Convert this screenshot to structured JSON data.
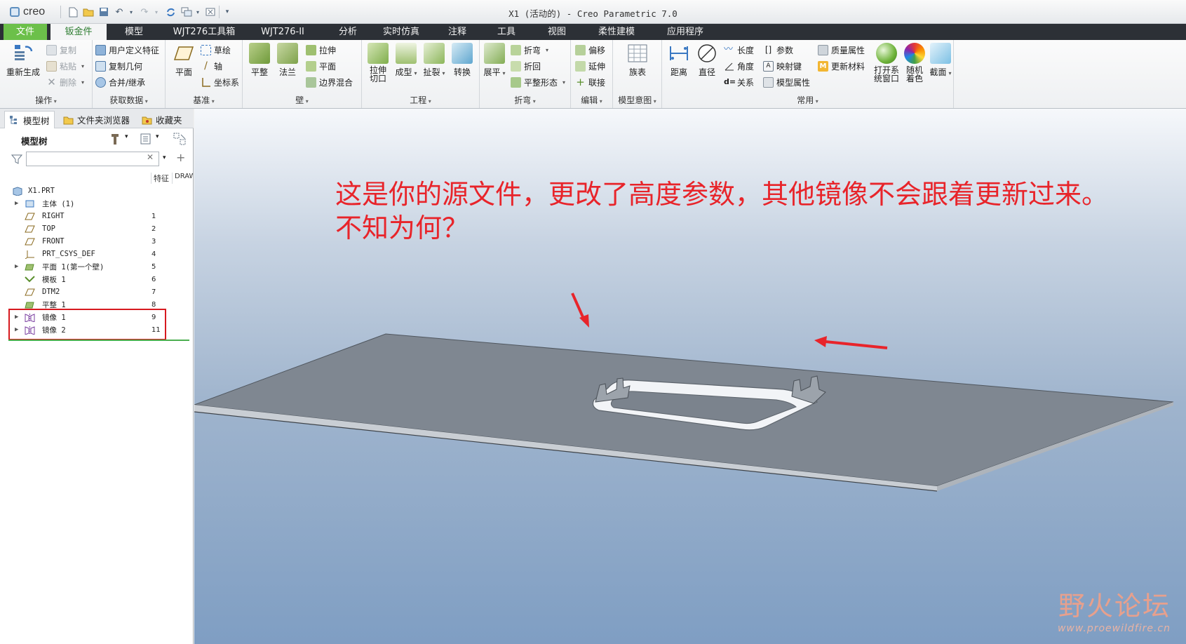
{
  "app": {
    "logo_text": "creo",
    "window_title": "X1 (活动的) - Creo Parametric 7.0"
  },
  "tabs": [
    {
      "label": "文件"
    },
    {
      "label": "钣金件"
    },
    {
      "label": "模型"
    },
    {
      "label": "WJT276工具箱"
    },
    {
      "label": "WJT276-II"
    },
    {
      "label": "分析"
    },
    {
      "label": "实时仿真"
    },
    {
      "label": "注释"
    },
    {
      "label": "工具"
    },
    {
      "label": "视图"
    },
    {
      "label": "柔性建模"
    },
    {
      "label": "应用程序"
    }
  ],
  "ribbon": {
    "operations": {
      "label": "操作",
      "regenerate": "重新生成",
      "copy": "复制",
      "paste": "粘贴",
      "delete": "删除"
    },
    "get_data": {
      "label": "获取数据",
      "udf": "用户定义特征",
      "copy_geom": "复制几何",
      "merge": "合并/继承"
    },
    "datum": {
      "label": "基准",
      "plane": "平面",
      "sketch": "草绘",
      "axis": "轴",
      "csys": "坐标系"
    },
    "wall": {
      "label": "壁",
      "flat": "平整",
      "flange": "法兰",
      "extrude": "拉伸",
      "planar": "平面",
      "blend": "边界混合"
    },
    "engineering": {
      "label": "工程",
      "extrude_cut": "拉伸切口",
      "form": "成型",
      "rip": "扯裂",
      "convert": "转换"
    },
    "bend": {
      "label": "折弯",
      "unbend": "展平",
      "bend": "折弯",
      "bend_back": "折回",
      "flat_pattern": "平整形态"
    },
    "edit": {
      "label": "编辑",
      "offset": "偏移",
      "extend": "延伸",
      "join": "联接"
    },
    "model_intent": {
      "label": "模型意图",
      "family_table": "族表"
    },
    "common": {
      "label": "常用",
      "distance": "距离",
      "diameter": "直径",
      "length": "长度",
      "angle": "角度",
      "relations": "关系",
      "parameters": "参数",
      "mapkey": "映射键",
      "model_props": "模型属性",
      "mass_props": "质量属性",
      "update_material": "更新材料",
      "open_system_window": "打开系统窗口",
      "random_color": "随机着色",
      "section": "截面"
    }
  },
  "panel": {
    "tabs": [
      "模型树",
      "文件夹浏览器",
      "收藏夹"
    ],
    "tree_title": "模型树",
    "search_placeholder": "",
    "columns": [
      "特征",
      "DRAW"
    ]
  },
  "tree": [
    {
      "label": "X1.PRT",
      "num": "",
      "icon": "part-icon",
      "expandable": false
    },
    {
      "label": "主体 (1)",
      "num": "",
      "icon": "body-icon",
      "expandable": true
    },
    {
      "label": "RIGHT",
      "num": "1",
      "icon": "datum-plane-icon",
      "expandable": false
    },
    {
      "label": "TOP",
      "num": "2",
      "icon": "datum-plane-icon",
      "expandable": false
    },
    {
      "label": "FRONT",
      "num": "3",
      "icon": "datum-plane-icon",
      "expandable": false
    },
    {
      "label": "PRT_CSYS_DEF",
      "num": "4",
      "icon": "csys-icon",
      "expandable": false
    },
    {
      "label": "平面 1(第一个壁)",
      "num": "5",
      "icon": "flat-wall-icon",
      "expandable": true
    },
    {
      "label": "模板 1",
      "num": "6",
      "icon": "form-icon",
      "expandable": false
    },
    {
      "label": "DTM2",
      "num": "7",
      "icon": "datum-plane-icon",
      "expandable": false
    },
    {
      "label": "平整 1",
      "num": "8",
      "icon": "flat-wall-icon",
      "expandable": false
    },
    {
      "label": "镜像 1",
      "num": "9",
      "icon": "mirror-icon",
      "expandable": true
    },
    {
      "label": "镜像 2",
      "num": "11",
      "icon": "mirror-icon",
      "expandable": true
    }
  ],
  "viewport": {
    "annotation_line1": "这是你的源文件，更改了高度参数，其他镜像不会跟着更新过来。",
    "annotation_line2": "不知为何？",
    "watermark_main": "野火论坛",
    "watermark_url": "www.proewildfire.cn"
  },
  "colors": {
    "tab_bar": "#2c3036",
    "file_tab": "#6cc04a",
    "annotation": "#e8242a",
    "highlight_box": "#d7191f"
  }
}
